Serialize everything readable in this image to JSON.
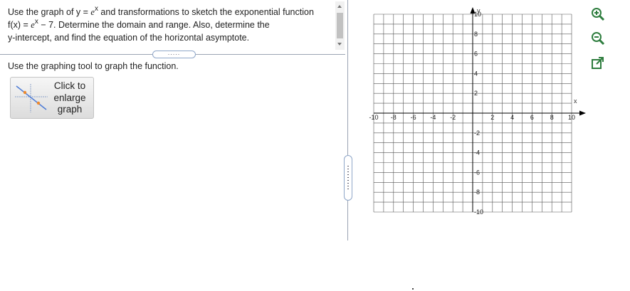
{
  "question": {
    "line1_pre": "Use the graph of y = ",
    "e": "e",
    "sup_x": "x",
    "line1_post": " and transformations to sketch the exponential function",
    "line2_pre": "f(x) = ",
    "line2_post": " − 7. Determine the domain and range. Also, determine the",
    "line3": "y-intercept, and find the equation of the horizontal asymptote."
  },
  "splitter_dots": ".....",
  "instruction": "Use the graphing tool to graph the function.",
  "enlarge_button": {
    "line1": "Click to",
    "line2": "enlarge",
    "line3": "graph"
  },
  "graph": {
    "x_axis_label": "x",
    "y_axis_label": "y",
    "x_tick_labels": [
      "-10",
      "-8",
      "-6",
      "-4",
      "-2",
      "2",
      "4",
      "6",
      "8",
      "10"
    ],
    "y_tick_labels": [
      "10",
      "8",
      "6",
      "4",
      "2",
      "-2",
      "-4",
      "-6",
      "-8",
      "-10"
    ],
    "range": [
      -10,
      10
    ],
    "grid": true
  },
  "toolbar": {
    "zoom_in_icon": "zoom-in-icon",
    "zoom_out_icon": "zoom-out-icon",
    "popout_icon": "external-link-icon"
  }
}
